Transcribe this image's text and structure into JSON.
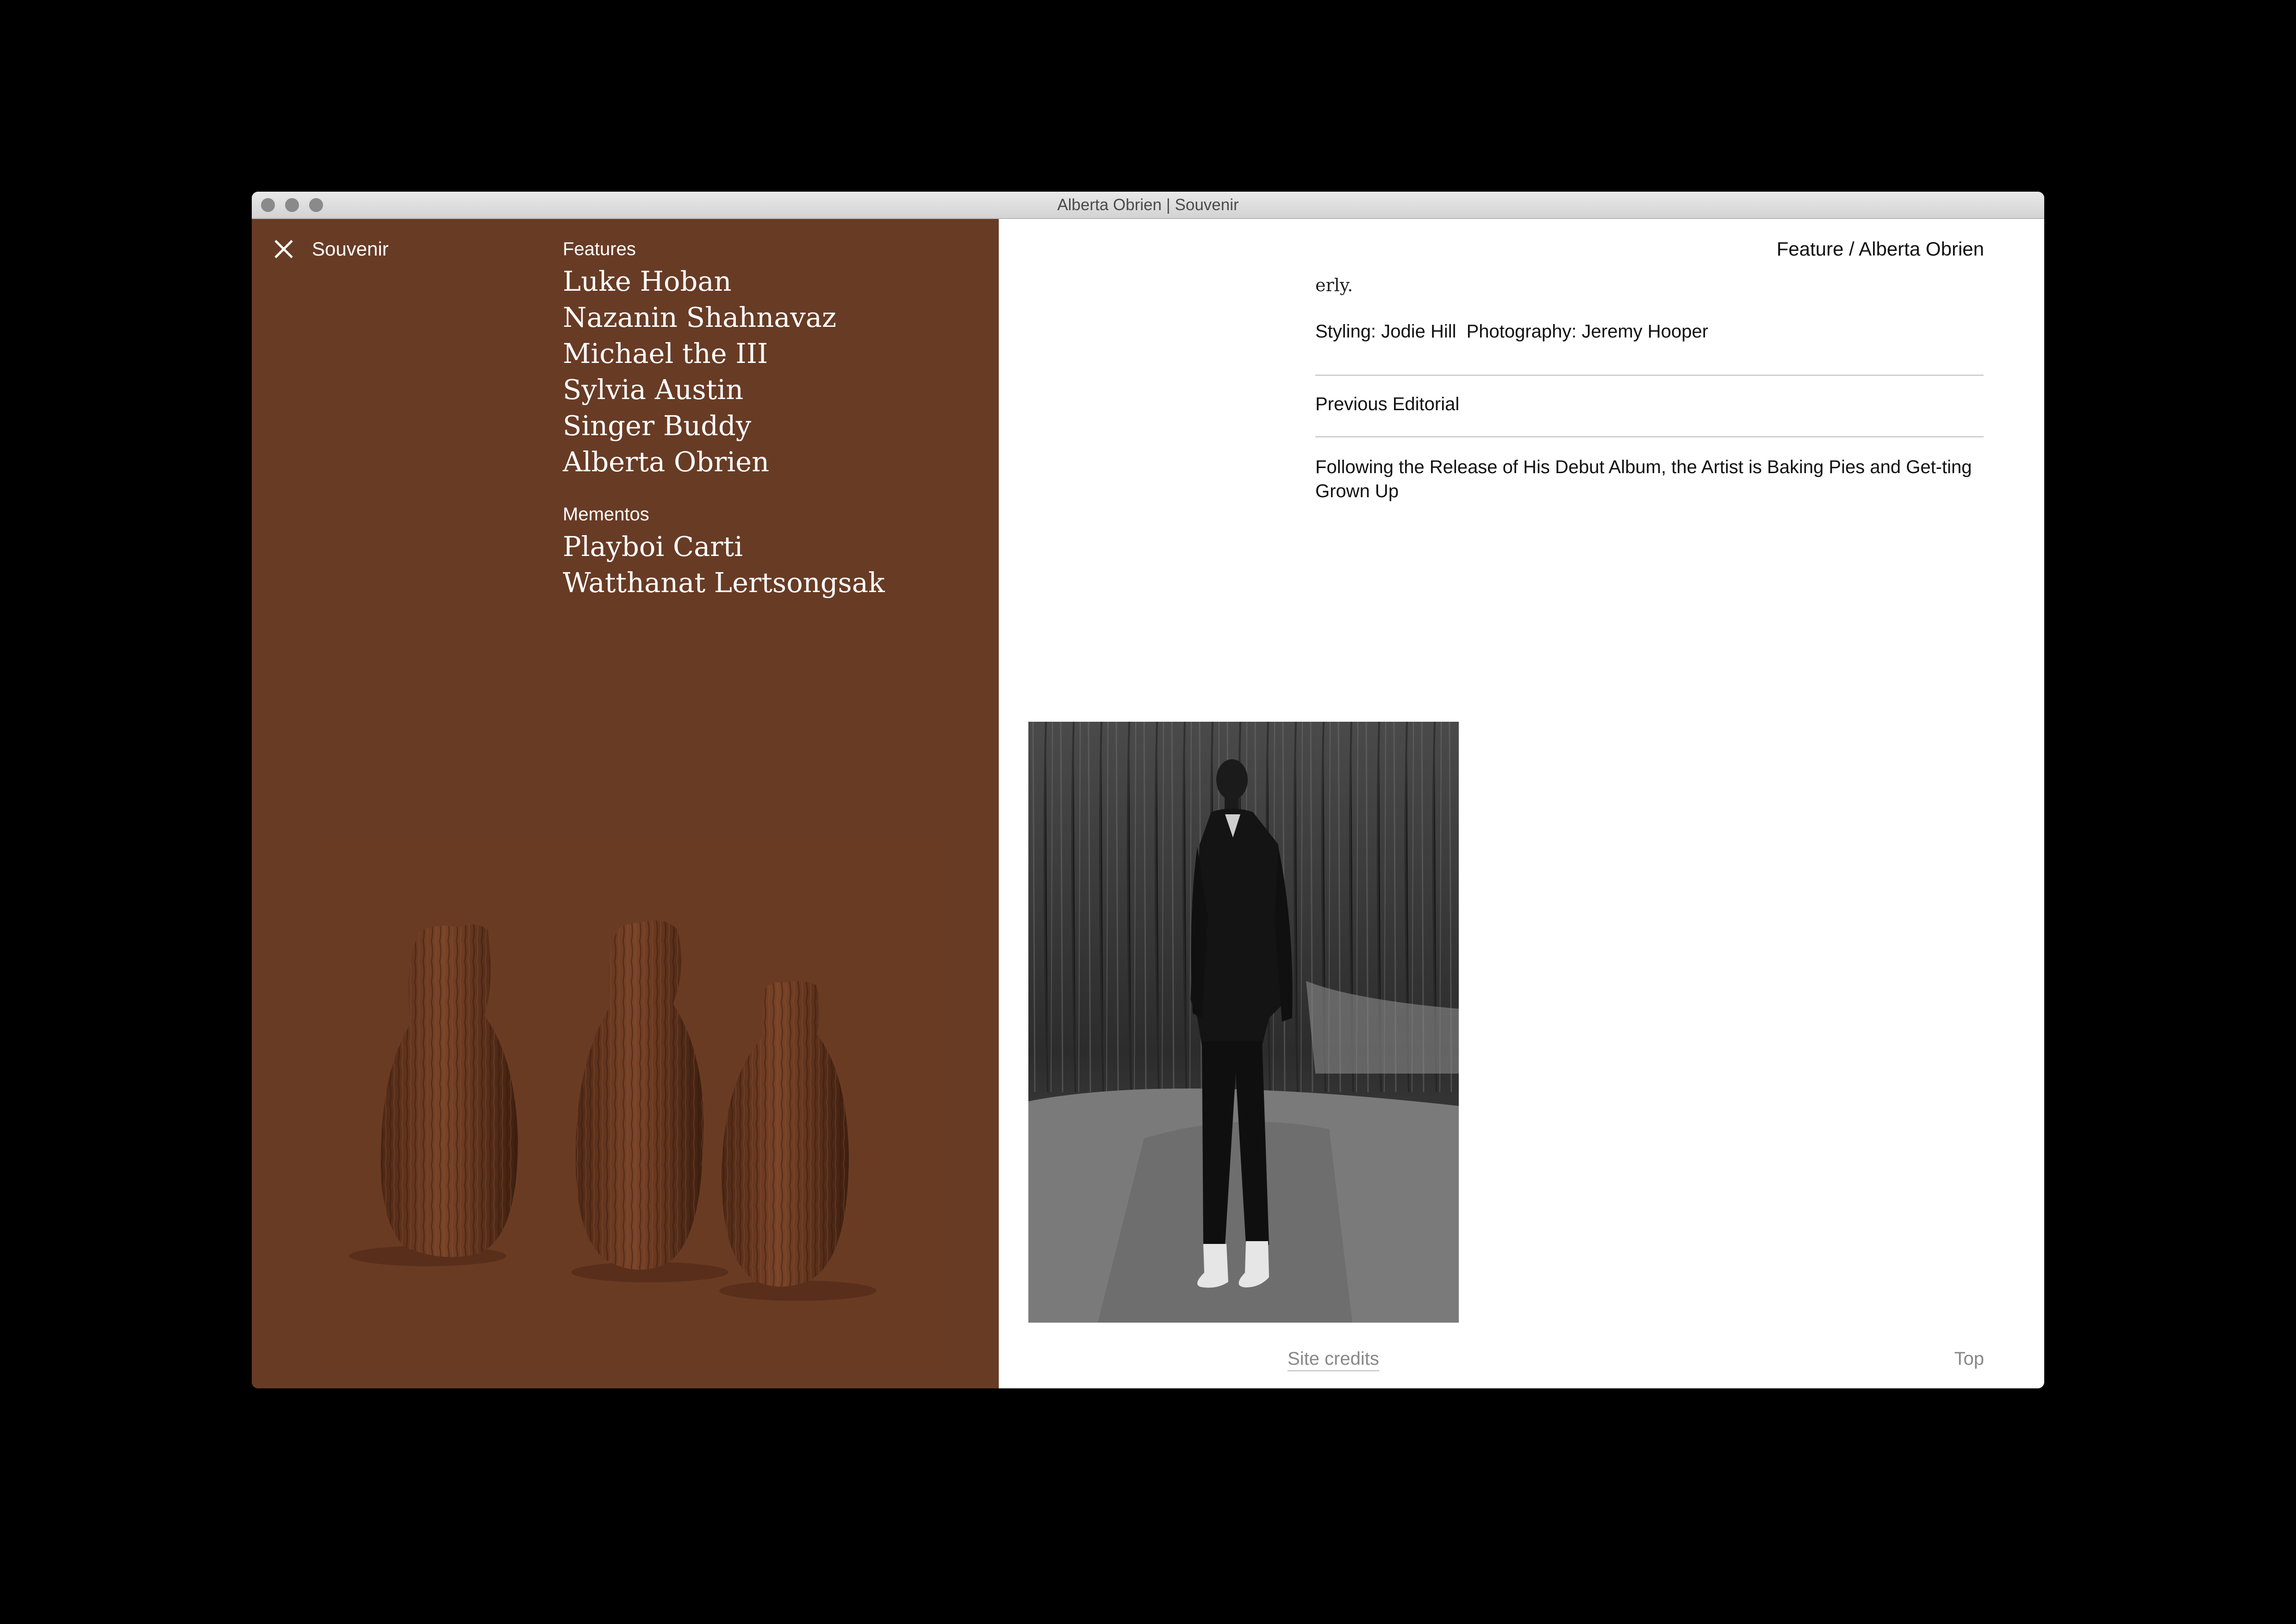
{
  "window": {
    "title": "Alberta Obrien | Souvenir"
  },
  "sidebar": {
    "brand": "Souvenir",
    "close_icon": "close-x-icon",
    "features_heading": "Features",
    "features": [
      "Luke Hoban",
      "Nazanin Shahnavaz",
      "Michael the III",
      "Sylvia Austin",
      "Singer Buddy",
      "Alberta Obrien"
    ],
    "mementos_heading": "Mementos",
    "mementos": [
      "Playboi Carti",
      "Watthanat Lertsongsak"
    ],
    "background_color": "#683b25"
  },
  "article": {
    "breadcrumb": "Feature / Alberta Obrien",
    "text_fragment": "erly.",
    "styling_credit": "Styling: Jodie Hill",
    "photography_credit": "Photography: Jeremy Hooper",
    "previous_label": "Previous Editorial",
    "previous_title": "Following the Release of His Debut Album, the Artist is Baking Pies and Get-ting Grown Up"
  },
  "footer": {
    "site_credits": "Site credits",
    "top": "Top"
  }
}
